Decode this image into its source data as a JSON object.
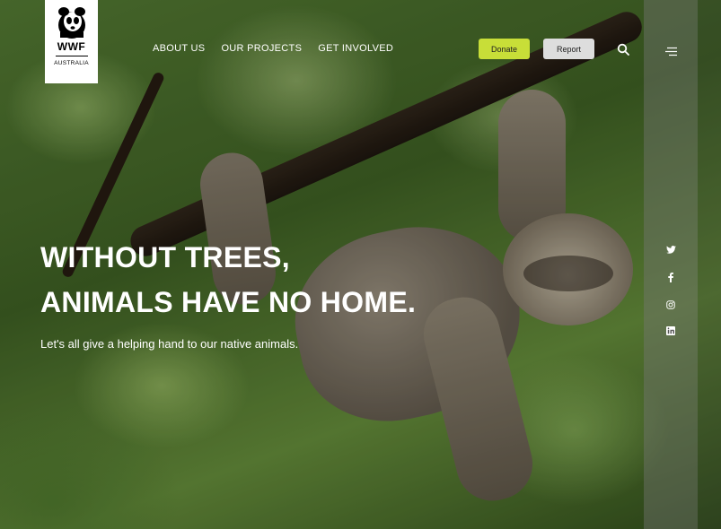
{
  "logo": {
    "brand": "WWF",
    "country": "AUSTRALIA"
  },
  "nav": {
    "items": [
      "ABOUT US",
      "OUR PROJECTS",
      "GET INVOLVED"
    ]
  },
  "actions": {
    "donate_label": "Donate",
    "report_label": "Report"
  },
  "hero": {
    "headline_line1": "WITHOUT TREES,",
    "headline_line2": "ANIMALS HAVE NO HOME.",
    "subtitle": "Let's all give a helping hand to our native animals."
  },
  "social": {
    "icons": [
      "twitter-icon",
      "facebook-icon",
      "instagram-icon",
      "linkedin-icon"
    ]
  },
  "colors": {
    "donate": "#c8de38",
    "report": "#dddddd",
    "sidebar": "rgba(120,120,120,0.42)"
  }
}
